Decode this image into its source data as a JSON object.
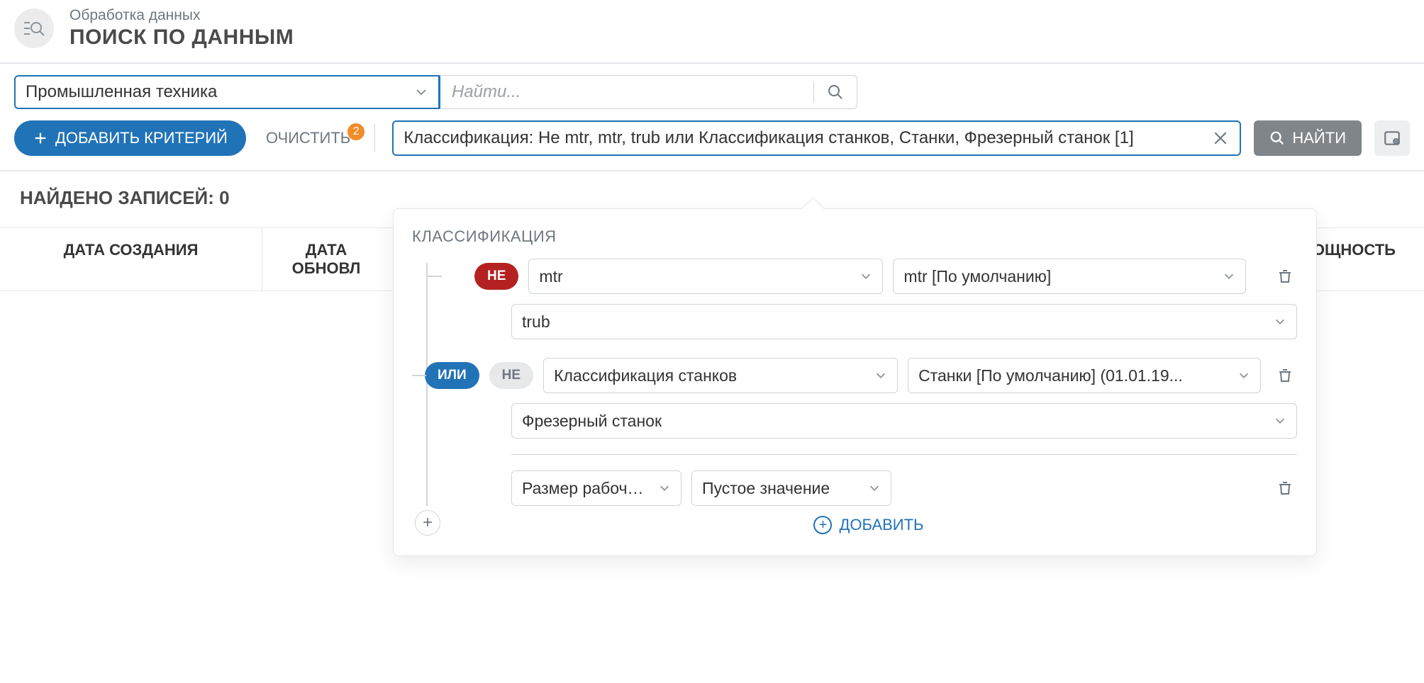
{
  "header": {
    "breadcrumb": "Обработка данных",
    "title": "ПОИСК ПО ДАННЫМ"
  },
  "searchRow": {
    "category": "Промышленная техника",
    "placeholder": "Найти..."
  },
  "criteriaBar": {
    "addLabel": "ДОБАВИТЬ КРИТЕРИЙ",
    "clearLabel": "ОЧИСТИТЬ",
    "clearCount": "2",
    "chipText": "Классификация: Не mtr, mtr, trub или Классификация станков, Станки, Фрезерный станок [1]",
    "findLabel": "НАЙТИ"
  },
  "results": {
    "countLabel": "НАЙДЕНО ЗАПИСЕЙ: 0",
    "columns": {
      "created": "ДАТА СОЗДАНИЯ",
      "updated": "ДАТА ОБНОВЛ",
      "power": "МОЩНОСТЬ"
    }
  },
  "popover": {
    "title": "КЛАССИФИКАЦИЯ",
    "notLabel": "НЕ",
    "orLabel": "ИЛИ",
    "row1": {
      "attr": "mtr",
      "version": "mtr [По умолчанию]"
    },
    "row2": {
      "value": "trub"
    },
    "row3": {
      "attr": "Классификация станков",
      "version": "Станки [По умолчанию] (01.01.19..."
    },
    "row4": {
      "value": "Фрезерный станок"
    },
    "row5": {
      "attr": "Размер рабочег...",
      "op": "Пустое значение"
    },
    "addLabel": "ДОБАВИТЬ"
  }
}
